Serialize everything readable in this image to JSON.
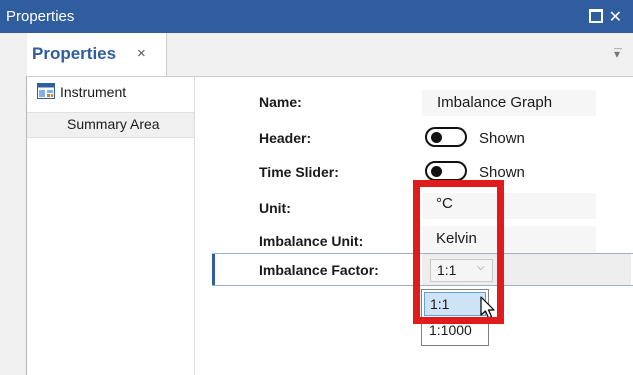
{
  "window": {
    "title": "Properties"
  },
  "tab": {
    "label": "Properties",
    "close": "×"
  },
  "tree": {
    "items": [
      {
        "label": "Instrument"
      },
      {
        "label": "Summary Area"
      }
    ]
  },
  "props": {
    "name": {
      "label": "Name:",
      "value": "Imbalance Graph"
    },
    "header": {
      "label": "Header:",
      "state": "Shown"
    },
    "time_slider": {
      "label": "Time Slider:",
      "state": "Shown"
    },
    "unit": {
      "label": "Unit:",
      "value": "°C"
    },
    "imbalance_unit": {
      "label": "Imbalance Unit:",
      "value": "Kelvin"
    },
    "imbalance_factor": {
      "label": "Imbalance Factor:",
      "value": "1:1",
      "options": [
        "1:1",
        "1:1000"
      ]
    }
  },
  "colors": {
    "accent": "#2f5d9e",
    "highlight": "#e01b1b",
    "selection": "#cfe3f7"
  },
  "icons": [
    "maximize-icon",
    "close-icon",
    "overflow-icon",
    "instrument-icon",
    "chevron-down-icon",
    "mouse-pointer-icon"
  ]
}
